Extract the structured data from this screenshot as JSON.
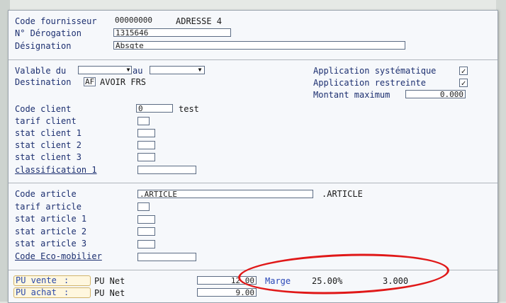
{
  "supplier": {
    "code_label": "Code fournisseur",
    "code_value": "00000000",
    "address": "ADRESSE 4",
    "derogation_label": "N° Dérogation",
    "derogation_value": "1315646",
    "designation_label": "Désignation",
    "designation_value": "Absgte"
  },
  "validity": {
    "from_label": "Valable du",
    "to_label": "au",
    "from_value": "",
    "to_value": "",
    "destination_label": "Destination",
    "destination_code": "AF",
    "destination_value": "AVOIR FRS",
    "app_systematic_label": "Application systématique",
    "app_systematic_checked": "✓",
    "app_restricted_label": "Application restreinte",
    "app_restricted_checked": "✓",
    "max_amount_label": "Montant maximum",
    "max_amount_value": "0.000"
  },
  "client": {
    "code_label": "Code client",
    "code_value": "0",
    "code_name": "test",
    "tarif_label": "tarif client",
    "stat1_label": "stat client 1",
    "stat2_label": "stat client 2",
    "stat3_label": "stat client 3",
    "classification_label": "classification 1"
  },
  "article": {
    "code_label": "Code article",
    "code_value": ".ARTICLE",
    "code_name": ".ARTICLE",
    "tarif_label": "tarif article",
    "stat1_label": "stat article 1",
    "stat2_label": "stat article 2",
    "stat3_label": "stat article 3",
    "eco_label": "Code Eco-mobilier"
  },
  "pricing": {
    "pu_vente_label": "PU vente",
    "pu_achat_label": "PU achat",
    "colon": ":",
    "pu_net_label": "PU Net",
    "pu_vente_value": "12.00",
    "pu_achat_value": "9.00",
    "marge_label": "Marge",
    "marge_percent": "25.00%",
    "marge_value": "3.000"
  },
  "colors": {
    "label": "#1c2f70",
    "highlight_ellipse": "#e01818",
    "pu_button_border": "#d2b46a"
  }
}
